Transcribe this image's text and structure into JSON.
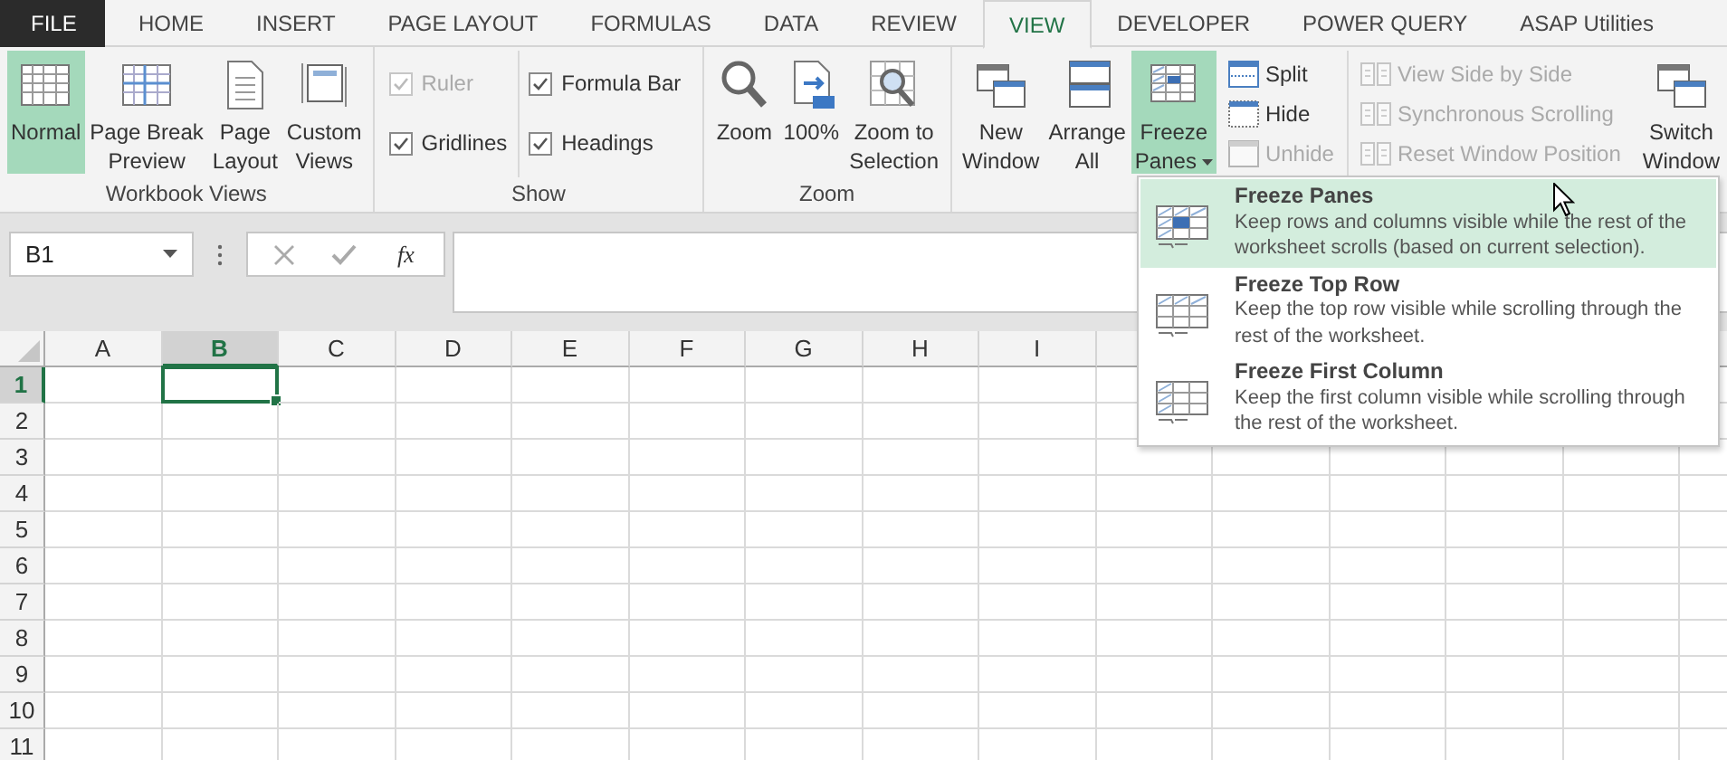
{
  "tabs": [
    {
      "label": "FILE",
      "kind": "file"
    },
    {
      "label": "HOME",
      "kind": "tab",
      "selected": false
    },
    {
      "label": "INSERT",
      "kind": "tab",
      "selected": false
    },
    {
      "label": "PAGE LAYOUT",
      "kind": "tab",
      "selected": false
    },
    {
      "label": "FORMULAS",
      "kind": "tab",
      "selected": false
    },
    {
      "label": "DATA",
      "kind": "tab",
      "selected": false
    },
    {
      "label": "REVIEW",
      "kind": "tab",
      "selected": false
    },
    {
      "label": "VIEW",
      "kind": "tab",
      "selected": true
    },
    {
      "label": "DEVELOPER",
      "kind": "tab",
      "selected": false
    },
    {
      "label": "POWER QUERY",
      "kind": "tab",
      "selected": false
    },
    {
      "label": "ASAP Utilities",
      "kind": "tab",
      "selected": false
    }
  ],
  "ribbon": {
    "groups": [
      {
        "label": "Workbook Views",
        "items": [
          {
            "kind": "large",
            "label": "Normal",
            "selected": true
          },
          {
            "kind": "large",
            "label": "Page Break\nPreview",
            "selected": false
          },
          {
            "kind": "large",
            "label": "Page\nLayout",
            "selected": false
          },
          {
            "kind": "large",
            "label": "Custom\nViews",
            "selected": false
          }
        ]
      },
      {
        "label": "Show",
        "items": [
          {
            "kind": "stack",
            "items": [
              {
                "kind": "check",
                "label": "Ruler",
                "checked": true,
                "disabled": true
              },
              {
                "kind": "check",
                "label": "Gridlines",
                "checked": true,
                "disabled": false
              }
            ]
          },
          {
            "kind": "stack",
            "items": [
              {
                "kind": "check",
                "label": "Formula Bar",
                "checked": true,
                "disabled": false
              },
              {
                "kind": "check",
                "label": "Headings",
                "checked": true,
                "disabled": false
              }
            ]
          }
        ]
      },
      {
        "label": "Zoom",
        "items": [
          {
            "kind": "large",
            "label": "Zoom",
            "selected": false
          },
          {
            "kind": "large",
            "label": "100%",
            "selected": false
          },
          {
            "kind": "large",
            "label": "Zoom to\nSelection",
            "selected": false
          }
        ]
      },
      {
        "items": [
          {
            "kind": "large",
            "label": "New\nWindow",
            "selected": false
          },
          {
            "kind": "large",
            "label": "Arrange\nAll",
            "selected": false
          },
          {
            "kind": "large",
            "label": "Freeze\nPanes",
            "selected": true,
            "dropdown": true
          },
          {
            "kind": "stack",
            "items": [
              {
                "kind": "small",
                "label": "Split",
                "disabled": false
              },
              {
                "kind": "small",
                "label": "Hide",
                "disabled": false
              },
              {
                "kind": "small",
                "label": "Unhide",
                "disabled": true
              }
            ]
          },
          {
            "kind": "stack",
            "items": [
              {
                "kind": "small",
                "label": "View Side by Side",
                "disabled": true
              },
              {
                "kind": "small",
                "label": "Synchronous Scrolling",
                "disabled": true
              },
              {
                "kind": "small",
                "label": "Reset Window Position",
                "disabled": true
              }
            ]
          },
          {
            "kind": "large",
            "label": "Switch\nWindow",
            "selected": false
          }
        ]
      }
    ]
  },
  "formula_bar": {
    "name_box": "B1",
    "function_label": "fx"
  },
  "sheet": {
    "columns": [
      {
        "label": "A",
        "selected": false
      },
      {
        "label": "B",
        "selected": true
      },
      {
        "label": "C",
        "selected": false
      },
      {
        "label": "D",
        "selected": false
      },
      {
        "label": "E",
        "selected": false
      },
      {
        "label": "F",
        "selected": false
      },
      {
        "label": "G",
        "selected": false
      },
      {
        "label": "H",
        "selected": false
      },
      {
        "label": "I",
        "selected": false
      }
    ],
    "rows": [
      {
        "label": "1",
        "selected": true
      },
      {
        "label": "2",
        "selected": false
      },
      {
        "label": "3",
        "selected": false
      },
      {
        "label": "4",
        "selected": false
      },
      {
        "label": "5",
        "selected": false
      },
      {
        "label": "6",
        "selected": false
      },
      {
        "label": "7",
        "selected": false
      },
      {
        "label": "8",
        "selected": false
      },
      {
        "label": "9",
        "selected": false
      },
      {
        "label": "10",
        "selected": false
      },
      {
        "label": "11",
        "selected": false
      }
    ]
  },
  "menu": {
    "items": [
      {
        "title": "Freeze Panes",
        "description": "Keep rows and columns visible while the rest of the worksheet scrolls (based on current selection).",
        "selected": true
      },
      {
        "title": "Freeze Top Row",
        "description": "Keep the top row visible while scrolling through the rest of the worksheet.",
        "selected": false
      },
      {
        "title": "Freeze First Column",
        "description": "Keep the first column visible while scrolling through the rest of the worksheet.",
        "selected": false
      }
    ]
  }
}
